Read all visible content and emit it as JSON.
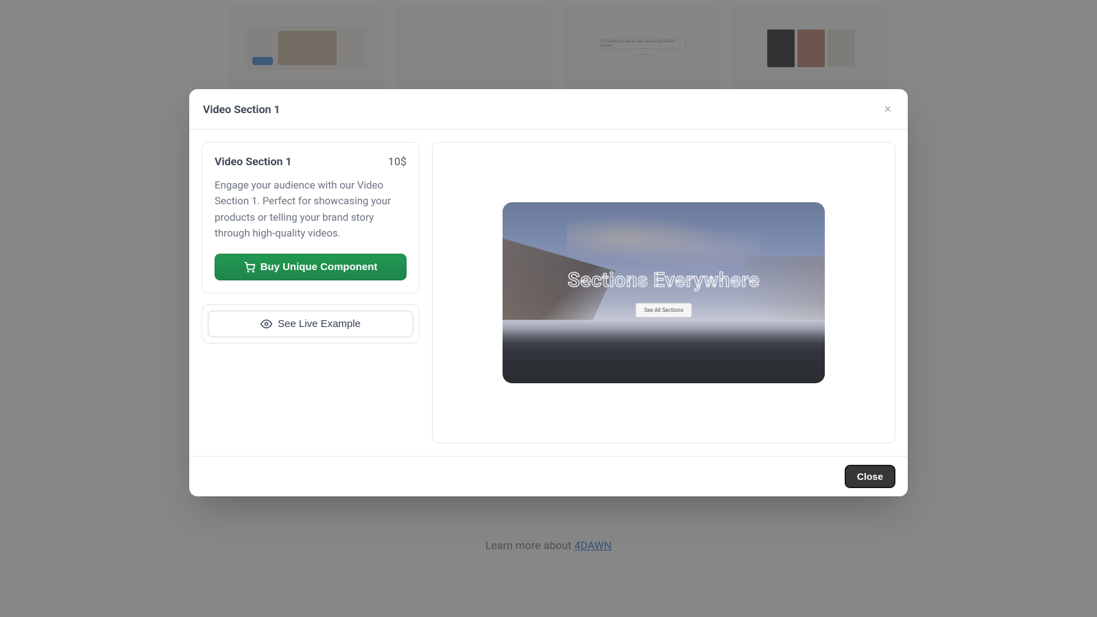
{
  "modal": {
    "title": "Video Section 1",
    "close_icon": "×"
  },
  "info": {
    "title": "Video Section 1",
    "price": "10$",
    "description": "Engage your audience with our Video Section 1. Perfect for showcasing your products or telling your brand story through high-quality videos.",
    "buy_label": "Buy Unique Component"
  },
  "example": {
    "label": "See Live Example"
  },
  "preview": {
    "title": "Sections Everywhere",
    "cta": "See All Sections"
  },
  "footer": {
    "close_label": "Close"
  },
  "page_footer": {
    "text": "Learn more about ",
    "link": "4DAWN"
  },
  "bg": {
    "thumb3_text": "4 D quality re-create to make text and the a-When domain"
  }
}
